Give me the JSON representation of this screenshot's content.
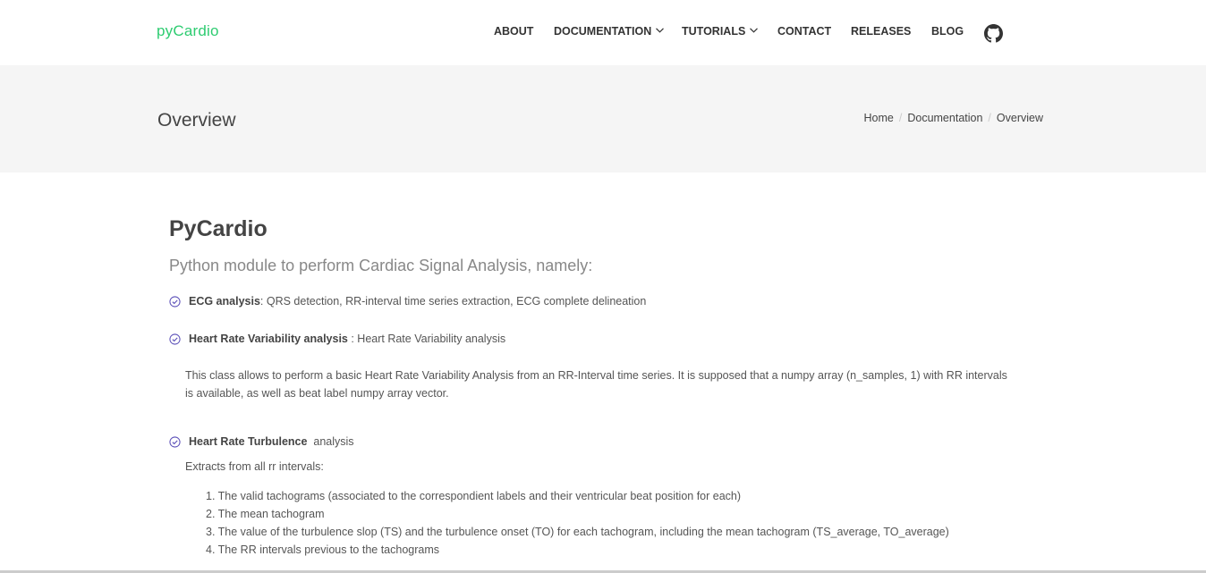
{
  "nav": {
    "brand": "pyCardio",
    "items": [
      {
        "label": "ABOUT",
        "dropdown": false
      },
      {
        "label": "DOCUMENTATION",
        "dropdown": true
      },
      {
        "label": "TUTORIALS",
        "dropdown": true
      },
      {
        "label": "CONTACT",
        "dropdown": false
      },
      {
        "label": "RELEASES",
        "dropdown": false
      },
      {
        "label": "BLOG",
        "dropdown": false
      }
    ],
    "github_icon": "github-icon"
  },
  "header": {
    "title": "Overview",
    "breadcrumb": [
      "Home",
      "Documentation",
      "Overview"
    ]
  },
  "content": {
    "heading": "PyCardio",
    "lead": "Python module to perform Cardiac Signal Analysis, namely:",
    "features": [
      {
        "title": "ECG analysis",
        "text": ": QRS detection, RR-interval time series extraction, ECG complete delineation"
      },
      {
        "title": "Heart Rate Variability analysis",
        "text": " : Heart Rate Variability analysis"
      },
      {
        "title": "Heart Rate Turbulence",
        "text": "  analysis"
      }
    ],
    "hrv_paragraph": "This class allows to perform a basic Heart Rate Variability Analysis from an RR-Interval time series. It is supposed that a numpy array (n_samples, 1) with RR intervals is available, as well as beat label numpy array vector.",
    "hrt_intro": "Extracts from all rr intervals:",
    "hrt_list": [
      "1. The valid tachograms (associated to the correspondient labels and their ventricular beat position for each)",
      "2. The mean tachogram",
      "3. The value of the turbulence slop (TS) and the turbulence onset (TO) for each tachogram, including the mean tachogram (TS_average, TO_average)",
      "4. The RR intervals previous to the tachograms"
    ]
  },
  "colors": {
    "brand": "#2ecc71",
    "check_icon": "#5b4fb8",
    "titlebar_bg": "#f5f5f5"
  }
}
